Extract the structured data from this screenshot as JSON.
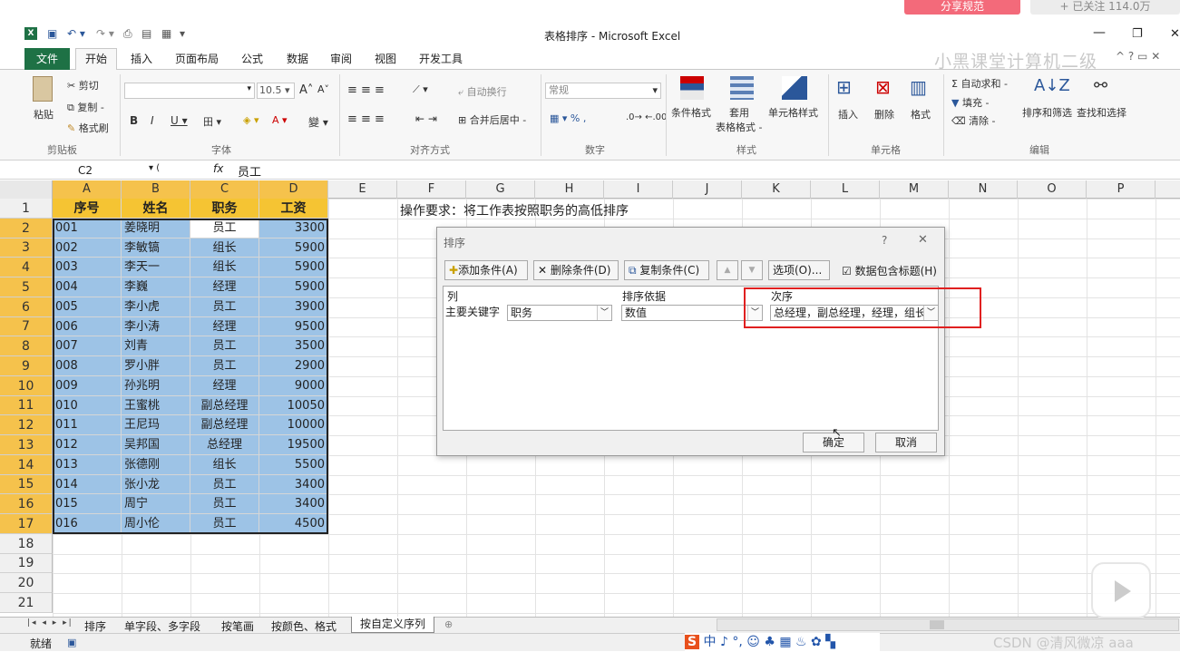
{
  "top_overlay": {
    "btn1": "分享规范",
    "btn2": "+ 已关注 114.0万"
  },
  "window": {
    "title": "表格排序 - Microsoft Excel",
    "watermark": "小黑课堂计算机二级"
  },
  "ribbon_tabs": [
    "文件",
    "开始",
    "插入",
    "页面布局",
    "公式",
    "数据",
    "审阅",
    "视图",
    "开发工具"
  ],
  "ribbon": {
    "paste": "粘贴",
    "cut": "剪切",
    "copy": "复制 -",
    "format_painter": "格式刷",
    "clipboard": "剪贴板",
    "font_size": "10.5",
    "font_group": "字体",
    "wrap_text": "自动换行",
    "merge_center": "合并后居中 -",
    "align_group": "对齐方式",
    "number_format": "常规",
    "number_group": "数字",
    "cond_format": "条件格式",
    "table_format": "套用",
    "table_format2": "表格格式 -",
    "cell_styles": "单元格样式",
    "styles_group": "样式",
    "insert": "插入",
    "delete": "删除",
    "format": "格式",
    "cells_group": "单元格",
    "autosum": "Σ 自动求和 -",
    "fill": "填充 -",
    "clear": "清除 -",
    "sort_filter": "排序和筛选",
    "find_select": "查找和选择",
    "edit_group": "编辑"
  },
  "formula_bar": {
    "name_box": "C2",
    "fx": "fx",
    "content": "员工"
  },
  "columns": [
    "A",
    "B",
    "C",
    "D",
    "E",
    "F",
    "G",
    "H",
    "I",
    "J",
    "K",
    "L",
    "M",
    "N",
    "O",
    "P"
  ],
  "rows": [
    "1",
    "2",
    "3",
    "4",
    "5",
    "6",
    "7",
    "8",
    "9",
    "10",
    "11",
    "12",
    "13",
    "14",
    "15",
    "16",
    "17",
    "18",
    "19",
    "20",
    "21"
  ],
  "header_row": [
    "序号",
    "姓名",
    "职务",
    "工资"
  ],
  "instruction": "操作要求：将工作表按照职务的高低排序",
  "table": [
    [
      "001",
      "姜晓明",
      "员工",
      "3300"
    ],
    [
      "002",
      "李敏镐",
      "组长",
      "5900"
    ],
    [
      "003",
      "李天一",
      "组长",
      "5900"
    ],
    [
      "004",
      "李巍",
      "经理",
      "5900"
    ],
    [
      "005",
      "李小虎",
      "员工",
      "3900"
    ],
    [
      "006",
      "李小涛",
      "经理",
      "9500"
    ],
    [
      "007",
      "刘青",
      "员工",
      "3500"
    ],
    [
      "008",
      "罗小胖",
      "员工",
      "2900"
    ],
    [
      "009",
      "孙兆明",
      "经理",
      "9000"
    ],
    [
      "010",
      "王蜜桃",
      "副总经理",
      "10050"
    ],
    [
      "011",
      "王尼玛",
      "副总经理",
      "10000"
    ],
    [
      "012",
      "吴邦国",
      "总经理",
      "19500"
    ],
    [
      "013",
      "张德刚",
      "组长",
      "5500"
    ],
    [
      "014",
      "张小龙",
      "员工",
      "3400"
    ],
    [
      "015",
      "周宁",
      "员工",
      "3400"
    ],
    [
      "016",
      "周小伦",
      "员工",
      "4500"
    ]
  ],
  "sheet_tabs": [
    "排序",
    "单字段、多字段",
    "按笔画",
    "按颜色、格式",
    "按自定义序列"
  ],
  "status": {
    "ready": "就绪",
    "watermark": "CSDN @清风微凉 aaa"
  },
  "dialog": {
    "title": "排序",
    "help": "?",
    "close": "✕",
    "add_level": "添加条件(A)",
    "delete_level": "删除条件(D)",
    "copy_level": "复制条件(C)",
    "options": "选项(O)...",
    "has_headers": "数据包含标题(H)",
    "col_header": "列",
    "sort_on_header": "排序依据",
    "order_header": "次序",
    "row_label": "主要关键字",
    "column_value": "职务",
    "sort_on_value": "数值",
    "order_value": "总经理，副总经理，经理，组长",
    "ok": "确定",
    "cancel": "取消"
  },
  "colors": {
    "header_fill": "#f5c433",
    "data_fill": "#9dc3e6",
    "selected_cell": "#ffffff",
    "highlight": "#e02020",
    "file_tab": "#1e7145",
    "top_btn": "#f36a7a"
  }
}
